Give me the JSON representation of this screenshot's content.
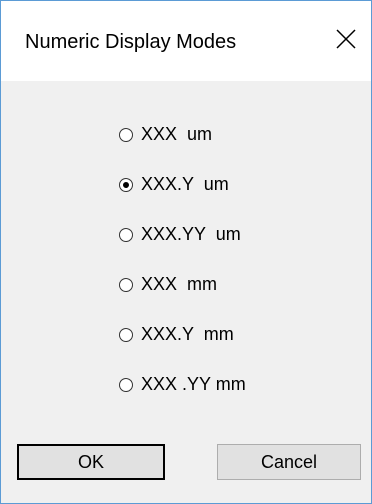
{
  "dialog": {
    "title": "Numeric Display Modes",
    "close_icon": "close-icon"
  },
  "options": [
    {
      "label": "XXX  um",
      "selected": false
    },
    {
      "label": "XXX.Y  um",
      "selected": true
    },
    {
      "label": "XXX.YY  um",
      "selected": false
    },
    {
      "label": "XXX  mm",
      "selected": false
    },
    {
      "label": "XXX.Y  mm",
      "selected": false
    },
    {
      "label": "XXX .YY mm",
      "selected": false
    }
  ],
  "buttons": {
    "ok_label": "OK",
    "cancel_label": "Cancel"
  }
}
